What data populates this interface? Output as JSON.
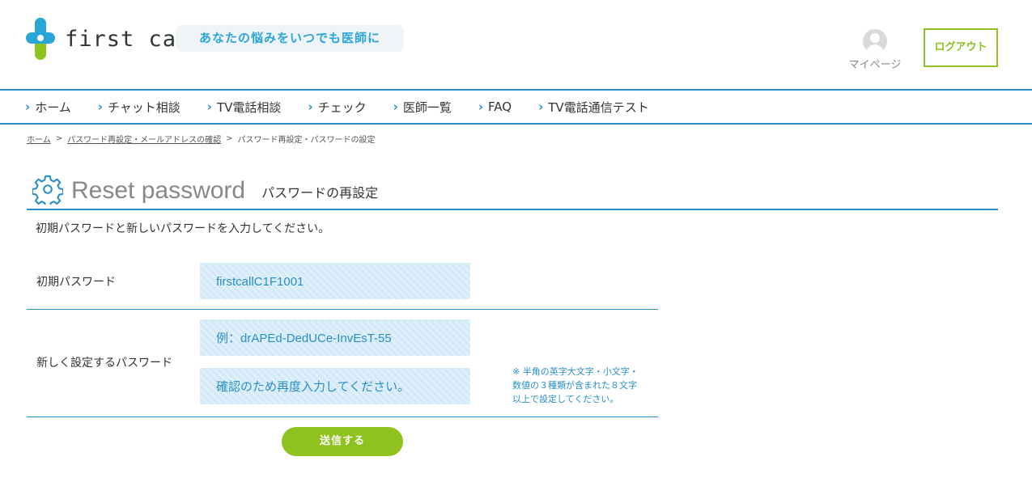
{
  "header": {
    "logo_text": "first call",
    "tagline": "あなたの悩みをいつでも医師に",
    "mypage_label": "マイページ",
    "logout_label": "ログアウト"
  },
  "nav": {
    "items": [
      {
        "label": "ホーム"
      },
      {
        "label": "チャット相談"
      },
      {
        "label": "TV電話相談"
      },
      {
        "label": "チェック"
      },
      {
        "label": "医師一覧"
      },
      {
        "label": "FAQ"
      },
      {
        "label": "TV電話通信テスト"
      }
    ]
  },
  "breadcrumb": {
    "home": "ホーム",
    "sep": ">",
    "step2": "パスワード再設定・メールアドレスの確認",
    "current": "パスワード再設定・パスワードの設定"
  },
  "page": {
    "title_en": "Reset password",
    "title_ja": "パスワードの再設定",
    "instruction": "初期パスワードと新しいパスワードを入力してください。"
  },
  "form": {
    "initial_label": "初期パスワード",
    "initial_value": "firstcallC1F1001",
    "new_label": "新しく設定するパスワード",
    "new_placeholder": "例：drAPEd-DedUCe-InvEsT-55",
    "confirm_placeholder": "確認のため再度入力してください。",
    "note_line1": "※ 半角の英字大文字・小文字・",
    "note_line2": "数値の３種類が含まれた８文字",
    "note_line3": "以上で設定してください。",
    "submit_label": "送信する"
  },
  "colors": {
    "brand_blue": "#2a8fc8",
    "brand_green": "#8ec21f"
  }
}
